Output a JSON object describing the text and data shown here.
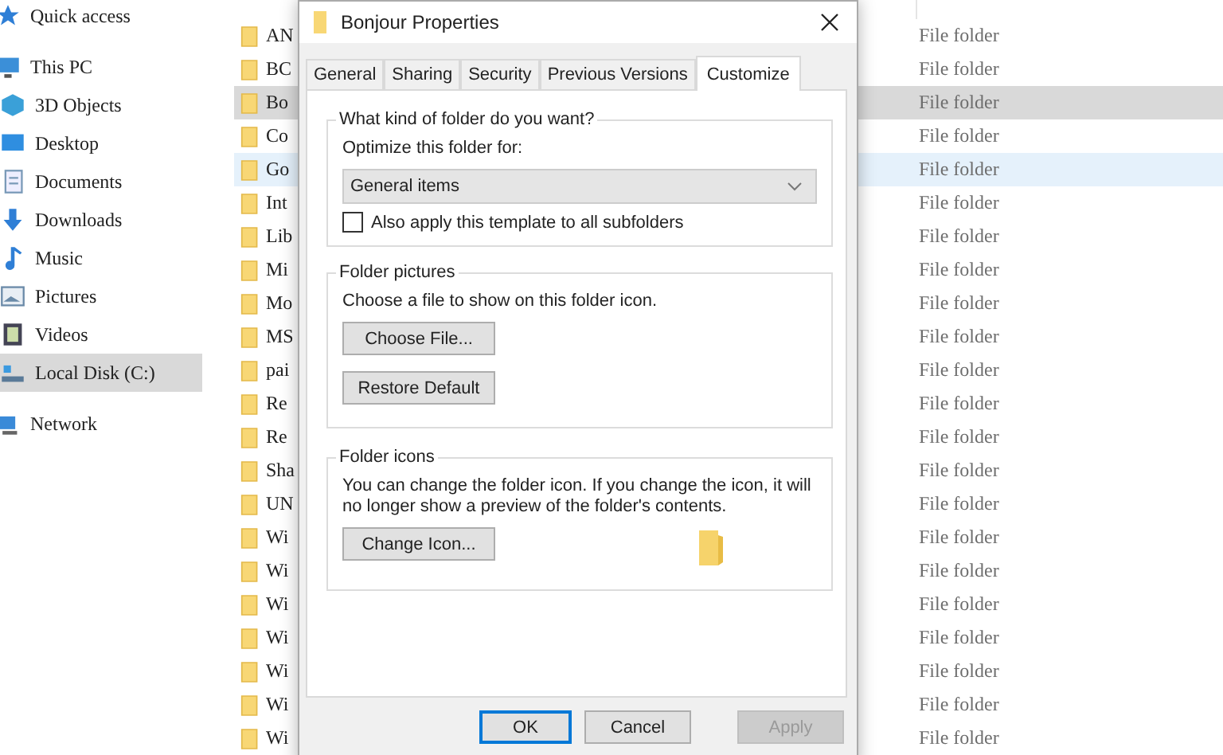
{
  "sidebar": {
    "items": [
      {
        "label": "Quick access",
        "kind": "star",
        "selected": false
      },
      {
        "label": "This PC",
        "kind": "pc",
        "selected": false,
        "children": [
          {
            "label": "3D Objects",
            "kind": "cube",
            "selected": false
          },
          {
            "label": "Desktop",
            "kind": "desktop",
            "selected": false
          },
          {
            "label": "Documents",
            "kind": "document",
            "selected": false
          },
          {
            "label": "Downloads",
            "kind": "download",
            "selected": false
          },
          {
            "label": "Music",
            "kind": "music",
            "selected": false
          },
          {
            "label": "Pictures",
            "kind": "picture",
            "selected": false
          },
          {
            "label": "Videos",
            "kind": "video",
            "selected": false
          },
          {
            "label": "Local Disk (C:)",
            "kind": "disk",
            "selected": true
          }
        ]
      },
      {
        "label": "Network",
        "kind": "network",
        "selected": false
      }
    ]
  },
  "file_list": {
    "rows": [
      {
        "name": "AN",
        "type": "File folder",
        "selected": false,
        "hovered": false
      },
      {
        "name": "BC",
        "type": "File folder",
        "selected": false,
        "hovered": false
      },
      {
        "name": "Bo",
        "type": "File folder",
        "selected": true,
        "hovered": false
      },
      {
        "name": "Co",
        "type": "File folder",
        "selected": false,
        "hovered": false
      },
      {
        "name": "Go",
        "type": "File folder",
        "selected": false,
        "hovered": true
      },
      {
        "name": "Int",
        "type": "File folder",
        "selected": false,
        "hovered": false
      },
      {
        "name": "Lib",
        "type": "File folder",
        "selected": false,
        "hovered": false
      },
      {
        "name": "Mi",
        "type": "File folder",
        "selected": false,
        "hovered": false
      },
      {
        "name": "Mo",
        "type": "File folder",
        "selected": false,
        "hovered": false
      },
      {
        "name": "MS",
        "type": "File folder",
        "selected": false,
        "hovered": false
      },
      {
        "name": "pai",
        "type": "File folder",
        "selected": false,
        "hovered": false
      },
      {
        "name": "Re",
        "type": "File folder",
        "selected": false,
        "hovered": false
      },
      {
        "name": "Re",
        "type": "File folder",
        "selected": false,
        "hovered": false
      },
      {
        "name": "Sha",
        "type": "File folder",
        "selected": false,
        "hovered": false
      },
      {
        "name": "UN",
        "type": "File folder",
        "selected": false,
        "hovered": false
      },
      {
        "name": "Wi",
        "type": "File folder",
        "selected": false,
        "hovered": false
      },
      {
        "name": "Wi",
        "type": "File folder",
        "selected": false,
        "hovered": false
      },
      {
        "name": "Wi",
        "type": "File folder",
        "selected": false,
        "hovered": false
      },
      {
        "name": "Wi",
        "type": "File folder",
        "selected": false,
        "hovered": false
      },
      {
        "name": "Wi",
        "type": "File folder",
        "selected": false,
        "hovered": false
      },
      {
        "name": "Wi",
        "type": "File folder",
        "selected": false,
        "hovered": false
      },
      {
        "name": "Wi",
        "type": "File folder",
        "selected": false,
        "hovered": false
      }
    ]
  },
  "dialog": {
    "title": "Bonjour Properties",
    "tabs": [
      {
        "label": "General",
        "selected": false
      },
      {
        "label": "Sharing",
        "selected": false
      },
      {
        "label": "Security",
        "selected": false
      },
      {
        "label": "Previous Versions",
        "selected": false
      },
      {
        "label": "Customize",
        "selected": true
      }
    ],
    "folder_type": {
      "heading": "What kind of folder do you want?",
      "label": "Optimize this folder for:",
      "value": "General items",
      "checkbox": {
        "label": "Also apply this template to all subfolders",
        "checked": false
      }
    },
    "folder_pictures": {
      "heading": "Folder pictures",
      "text": "Choose a file to show on this folder icon.",
      "buttons": [
        "Choose File...",
        "Restore Default"
      ]
    },
    "folder_icons": {
      "heading": "Folder icons",
      "text": "You can change the folder icon. If you change the icon, it will no longer show a preview of the folder's contents.",
      "button": "Change Icon..."
    },
    "buttons": [
      {
        "label": "OK",
        "kind": "default",
        "disabled": false
      },
      {
        "label": "Cancel",
        "kind": "normal",
        "disabled": false
      },
      {
        "label": "Apply",
        "kind": "normal",
        "disabled": true
      }
    ]
  }
}
